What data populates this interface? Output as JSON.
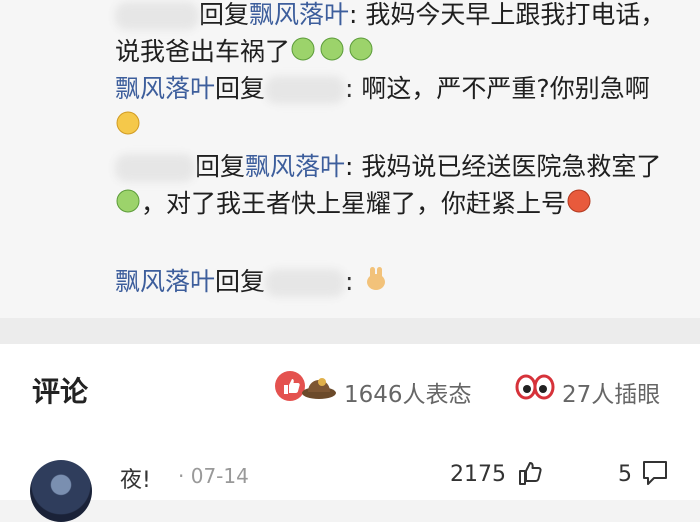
{
  "replies": [
    {
      "sender": "",
      "verb": "回复",
      "recipient": "飘风落叶",
      "sep": ":",
      "text": "我妈今天早上跟我打电话，说我爸出车祸了"
    },
    {
      "sender": "飘风落叶",
      "verb": "回复",
      "recipient": "",
      "sep": ":",
      "text": "啊这，严不严重?你别急啊"
    },
    {
      "sender": "",
      "verb": "回复",
      "recipient": "飘风落叶",
      "sep": ":",
      "text1": "我妈说已经送医院急救室了",
      "text2": "，对了我王者快上星耀了，你赶紧上号"
    },
    {
      "sender": "飘风落叶",
      "verb": "回复",
      "recipient": "",
      "sep": ":"
    }
  ],
  "comments_bar": {
    "title": "评论",
    "reactions": "1646人表态",
    "peeks": "27人插眼"
  },
  "comment": {
    "username": "夜!",
    "date": "· 07-14",
    "likes": "2175",
    "reply_count": "5"
  },
  "colors": {
    "name_link": "#3d5e9c",
    "like_icon": "#e4524f"
  }
}
